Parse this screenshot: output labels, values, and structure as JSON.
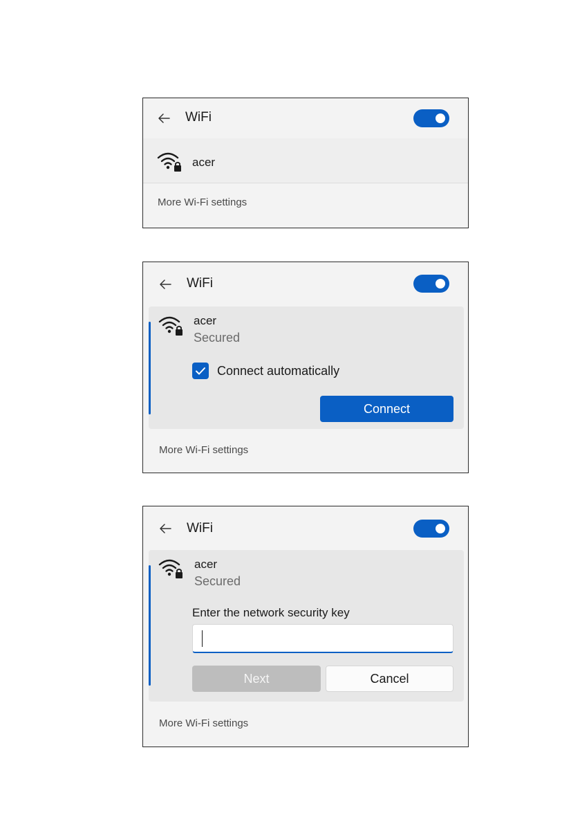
{
  "panels": [
    {
      "header": {
        "back_icon": "arrow-left-icon",
        "title": "WiFi",
        "toggle_on": true
      },
      "network": {
        "icon": "wifi-secured-icon",
        "name": "acer"
      },
      "footer": {
        "link": "More Wi-Fi settings"
      }
    },
    {
      "header": {
        "back_icon": "arrow-left-icon",
        "title": "WiFi",
        "toggle_on": true
      },
      "network": {
        "icon": "wifi-secured-icon",
        "name": "acer",
        "status": "Secured",
        "connect_automatically": {
          "label": "Connect automatically",
          "checked": true
        },
        "connect_label": "Connect"
      },
      "footer": {
        "link": "More Wi-Fi settings"
      }
    },
    {
      "header": {
        "back_icon": "arrow-left-icon",
        "title": "WiFi",
        "toggle_on": true
      },
      "network": {
        "icon": "wifi-secured-icon",
        "name": "acer",
        "status": "Secured",
        "key_prompt": "Enter the network security key",
        "key_value": "",
        "next_label": "Next",
        "cancel_label": "Cancel"
      },
      "footer": {
        "link": "More Wi-Fi settings"
      }
    }
  ],
  "colors": {
    "accent": "#0a5fc4",
    "panel_bg": "#f3f3f3",
    "expanded_bg": "#e7e7e7"
  }
}
